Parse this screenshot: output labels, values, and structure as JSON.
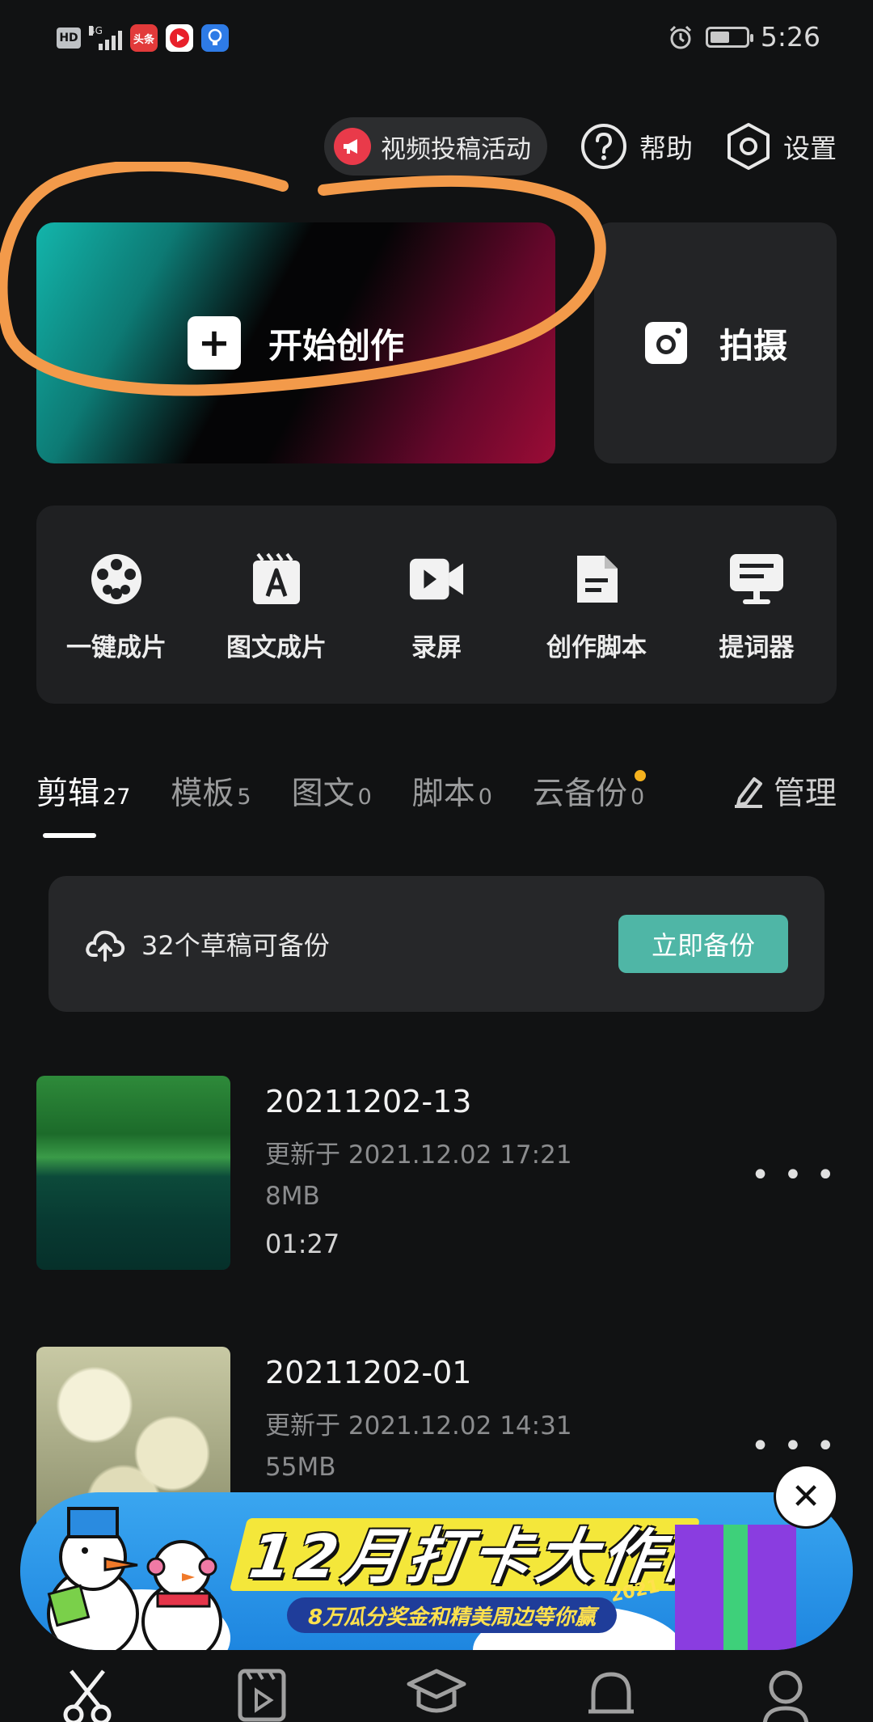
{
  "status_bar": {
    "time": "5:26",
    "network": "4G",
    "hd_label": "HD",
    "app_badge": "头条",
    "battery_level": 0.55
  },
  "header": {
    "campaign_label": "视频投稿活动",
    "help_label": "帮助",
    "settings_label": "设置"
  },
  "create": {
    "start_label": "开始创作",
    "shoot_label": "拍摄"
  },
  "tools": [
    {
      "label": "一键成片",
      "icon": "film-reel-icon"
    },
    {
      "label": "图文成片",
      "icon": "text-to-video-icon"
    },
    {
      "label": "录屏",
      "icon": "screen-record-icon"
    },
    {
      "label": "创作脚本",
      "icon": "script-doc-icon"
    },
    {
      "label": "提词器",
      "icon": "teleprompter-icon"
    }
  ],
  "tabs": [
    {
      "label": "剪辑",
      "count": "27",
      "active": true
    },
    {
      "label": "模板",
      "count": "5",
      "active": false
    },
    {
      "label": "图文",
      "count": "0",
      "active": false
    },
    {
      "label": "脚本",
      "count": "0",
      "active": false
    },
    {
      "label": "云备份",
      "count": "0",
      "active": false,
      "has_dot": true
    }
  ],
  "manage_label": "管理",
  "backup": {
    "text": "32个草稿可备份",
    "button": "立即备份"
  },
  "drafts": [
    {
      "name": "20211202-13",
      "updated": "更新于 2021.12.02 17:21",
      "size": "8MB",
      "duration": "01:27"
    },
    {
      "name": "20211202-01",
      "updated": "更新于 2021.12.02 14:31",
      "size": "55MB",
      "duration": ""
    }
  ],
  "banner": {
    "title": "12月打卡大作战",
    "subtitle": "8万瓜分奖金和精美周边等你赢",
    "year": "2021"
  },
  "colors": {
    "background": "#111213",
    "accent_teal": "#4fb6a6",
    "annotation_orange": "#f39a4a",
    "dot_yellow": "#f5b21e"
  },
  "bottom_nav": [
    {
      "icon": "scissors-icon"
    },
    {
      "icon": "template-play-icon"
    },
    {
      "icon": "graduation-cap-icon"
    },
    {
      "icon": "bell-icon"
    },
    {
      "icon": "profile-icon"
    }
  ]
}
